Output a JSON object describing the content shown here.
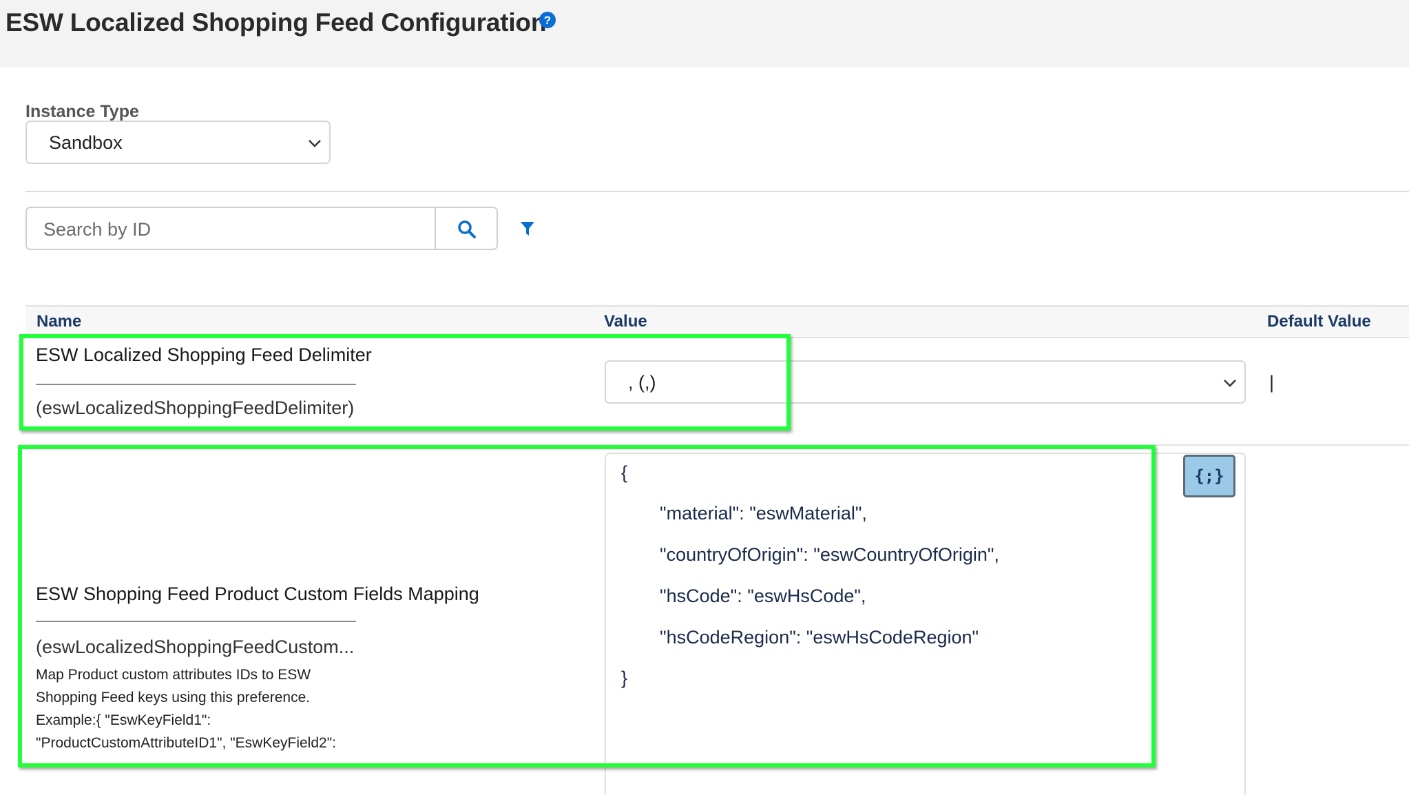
{
  "header": {
    "title": "ESW Localized Shopping Feed Configuration",
    "help_icon": "help-icon"
  },
  "instance": {
    "label": "Instance Type",
    "selected": "Sandbox"
  },
  "search": {
    "placeholder": "Search by ID",
    "search_icon": "search-icon",
    "filter_icon": "filter-icon"
  },
  "table": {
    "columns": [
      "Name",
      "Value",
      "Default Value"
    ],
    "rows": [
      {
        "name": "ESW Localized Shopping Feed Delimiter",
        "id": "(eswLocalizedShoppingFeedDelimiter)",
        "value": ", (,)",
        "default": "|"
      },
      {
        "name": "ESW Shopping Feed Product Custom Fields Mapping",
        "id": "(eswLocalizedShoppingFeedCustom...",
        "description": [
          "Map Product custom attributes IDs to ESW",
          "Shopping Feed keys using this preference.",
          "Example:{ \"EswKeyField1\":",
          "\"ProductCustomAttributeID1\", \"EswKeyField2\":"
        ],
        "value_lines": [
          "{",
          "\"material\": \"eswMaterial\",",
          "\"countryOfOrigin\": \"eswCountryOfOrigin\",",
          "\"hsCode\": \"eswHsCode\",",
          "\"hsCodeRegion\": \"eswHsCodeRegion\"",
          "}"
        ],
        "format_button_label": "{;}"
      }
    ]
  },
  "colors": {
    "highlight": "#22ff3a",
    "link_blue": "#0a6ed1",
    "header_text": "#1b3a63",
    "format_button_bg": "#9bc9e8"
  }
}
